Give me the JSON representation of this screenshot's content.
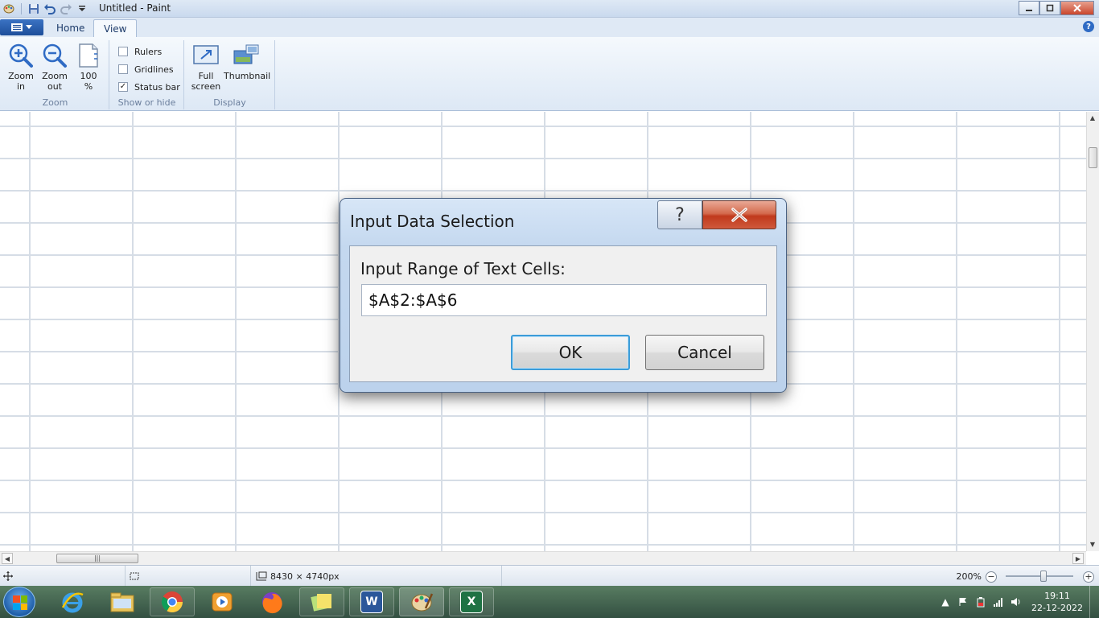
{
  "window": {
    "title": "Untitled - Paint"
  },
  "ribbon": {
    "tabs": [
      {
        "label": "Home"
      },
      {
        "label": "View"
      }
    ],
    "groups": {
      "zoom": {
        "label": "Zoom",
        "zoom_in": [
          "Zoom",
          "in"
        ],
        "zoom_out": [
          "Zoom",
          "out"
        ],
        "hundred": [
          "100",
          "%"
        ]
      },
      "show_hide": {
        "label": "Show or hide",
        "rulers": {
          "label": "Rulers",
          "checked": false
        },
        "gridlines": {
          "label": "Gridlines",
          "checked": false
        },
        "status_bar": {
          "label": "Status bar",
          "checked": true
        }
      },
      "display": {
        "label": "Display",
        "full_screen": [
          "Full",
          "screen"
        ],
        "thumbnail": "Thumbnail"
      }
    }
  },
  "dialog": {
    "title": "Input Data Selection",
    "help_glyph": "?",
    "close_glyph": "X",
    "field_label": "Input Range of Text Cells:",
    "field_value": "$A$2:$A$6",
    "ok_label": "OK",
    "cancel_label": "Cancel"
  },
  "statusbar": {
    "image_size": "8430 × 4740px",
    "zoom_level": "200%"
  },
  "taskbar": {
    "apps": [
      "internet-explorer",
      "file-explorer",
      "chrome",
      "media-player",
      "firefox",
      "sticky-notes",
      "word",
      "paint",
      "excel"
    ],
    "clock_time": "19:11",
    "clock_date": "22-12-2022"
  },
  "colors": {
    "accent": "#2f6bc4",
    "close_red": "#c9462c",
    "grid_line": "#d6dde6"
  }
}
